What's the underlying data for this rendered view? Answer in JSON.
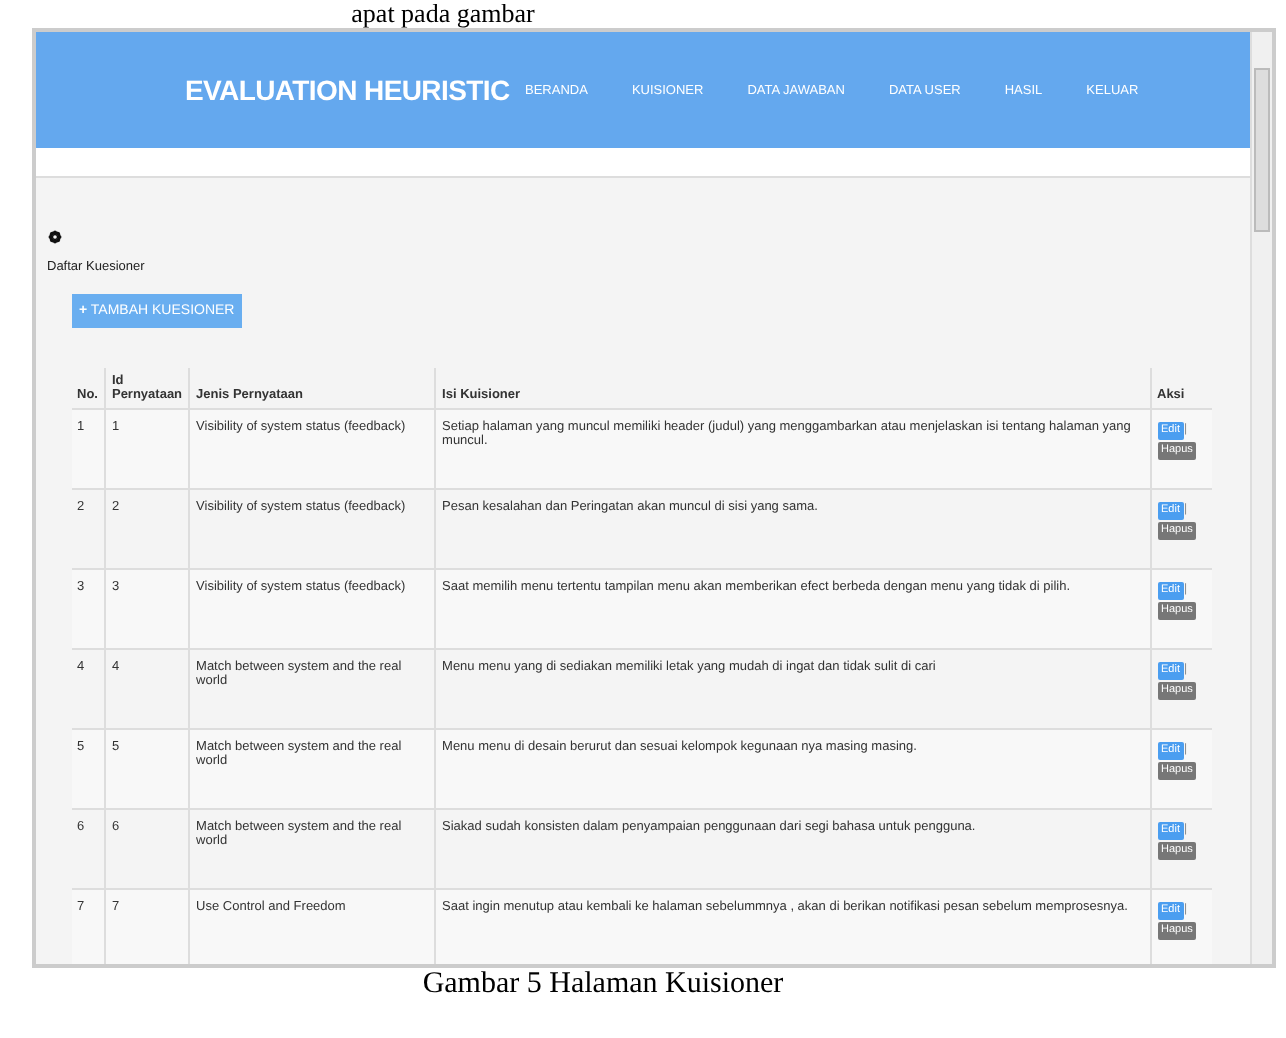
{
  "document": {
    "text_above": "apat pada gambar",
    "caption": "Gambar 5 Halaman Kuisioner"
  },
  "navbar": {
    "brand": "EVALUATION HEURISTIC",
    "items": [
      "BERANDA",
      "KUISIONER",
      "DATA JAWABAN",
      "DATA USER",
      "HASIL",
      "KELUAR"
    ]
  },
  "panel": {
    "heading": "Daftar Kuesioner",
    "add_button": {
      "icon": "+",
      "label": "TAMBAH KUESIONER"
    }
  },
  "table": {
    "columns": [
      "No.",
      "Id Pernyataan",
      "Jenis Pernyataan",
      "Isi Kuisioner",
      "Aksi"
    ],
    "rows": [
      {
        "no": "1",
        "id": "1",
        "jenis": "Visibility of system status (feedback)",
        "isi": "Setiap halaman yang muncul memiliki header (judul) yang menggambarkan atau menjelaskan isi tentang halaman yang muncul.",
        "actions": [
          "Edit",
          "|",
          "Hapus"
        ]
      },
      {
        "no": "2",
        "id": "2",
        "jenis": "Visibility of system status (feedback)",
        "isi": "Pesan kesalahan dan Peringatan akan muncul di sisi yang sama.",
        "actions": [
          "Edit",
          "|",
          "Hapus"
        ]
      },
      {
        "no": "3",
        "id": "3",
        "jenis": "Visibility of system status (feedback)",
        "isi": "Saat memilih menu tertentu tampilan menu akan memberikan efect berbeda dengan menu yang tidak di pilih.",
        "actions": [
          "Edit",
          "|",
          "Hapus"
        ]
      },
      {
        "no": "4",
        "id": "4",
        "jenis": "Match between system and the real world",
        "isi": "Menu menu yang di sediakan memiliki letak yang mudah di ingat dan tidak sulit di cari",
        "actions": [
          "Edit",
          "|",
          "Hapus"
        ]
      },
      {
        "no": "5",
        "id": "5",
        "jenis": "Match between system and the real world",
        "isi": "Menu menu di desain berurut dan sesuai kelompok kegunaan nya masing masing.",
        "actions": [
          "Edit",
          "|",
          "Hapus"
        ]
      },
      {
        "no": "6",
        "id": "6",
        "jenis": "Match between system and the real world",
        "isi": "Siakad sudah konsisten dalam penyampaian penggunaan dari segi bahasa untuk pengguna.",
        "actions": [
          "Edit",
          "|",
          "Hapus"
        ]
      },
      {
        "no": "7",
        "id": "7",
        "jenis": "Use Control and Freedom",
        "isi": "Saat ingin menutup atau kembali ke halaman sebelummnya , akan di berikan notifikasi pesan sebelum memprosesnya.",
        "actions": [
          "Edit",
          "|",
          "Hapus"
        ]
      }
    ]
  }
}
